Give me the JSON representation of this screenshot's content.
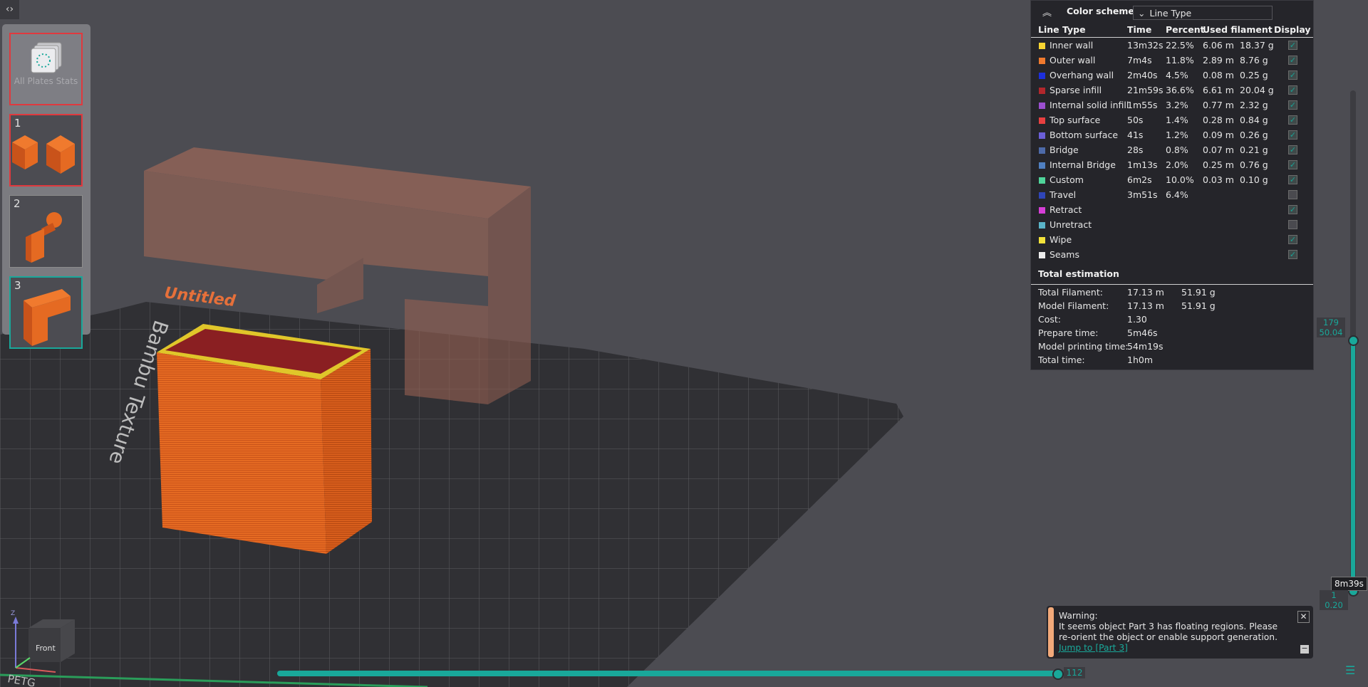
{
  "viewport": {
    "model_label": "Untitled",
    "bed_texture_text": "Bambu Texture",
    "bed_corner_text": "PETG"
  },
  "plates": {
    "all_stats_label": "All Plates Stats",
    "items": [
      {
        "number": "1",
        "thumbnail": "two-cubes-icon"
      },
      {
        "number": "2",
        "thumbnail": "joystick-part-icon"
      },
      {
        "number": "3",
        "thumbnail": "bracket-part-icon"
      }
    ]
  },
  "legend": {
    "title": "Color scheme",
    "scheme_value": "Line Type",
    "headers": {
      "type": "Line Type",
      "time": "Time",
      "percent": "Percent",
      "used": "Used filament",
      "display": "Display"
    },
    "rows": [
      {
        "name": "Inner wall",
        "color": "#f7d432",
        "time": "13m32s",
        "percent": "22.5%",
        "meters": "6.06 m",
        "grams": "18.37 g",
        "display": true
      },
      {
        "name": "Outer wall",
        "color": "#f07a2e",
        "time": "7m4s",
        "percent": "11.8%",
        "meters": "2.89 m",
        "grams": "8.76 g",
        "display": true
      },
      {
        "name": "Overhang wall",
        "color": "#1d2fdc",
        "time": "2m40s",
        "percent": "4.5%",
        "meters": "0.08 m",
        "grams": "0.25 g",
        "display": true
      },
      {
        "name": "Sparse infill",
        "color": "#b2272c",
        "time": "21m59s",
        "percent": "36.6%",
        "meters": "6.61 m",
        "grams": "20.04 g",
        "display": true
      },
      {
        "name": "Internal solid infill",
        "color": "#9b4fd0",
        "time": "1m55s",
        "percent": "3.2%",
        "meters": "0.77 m",
        "grams": "2.32 g",
        "display": true
      },
      {
        "name": "Top surface",
        "color": "#e84040",
        "time": "50s",
        "percent": "1.4%",
        "meters": "0.28 m",
        "grams": "0.84 g",
        "display": true
      },
      {
        "name": "Bottom surface",
        "color": "#6b5fd8",
        "time": "41s",
        "percent": "1.2%",
        "meters": "0.09 m",
        "grams": "0.26 g",
        "display": true
      },
      {
        "name": "Bridge",
        "color": "#4d6aa8",
        "time": "28s",
        "percent": "0.8%",
        "meters": "0.07 m",
        "grams": "0.21 g",
        "display": true
      },
      {
        "name": "Internal Bridge",
        "color": "#4f7fc0",
        "time": "1m13s",
        "percent": "2.0%",
        "meters": "0.25 m",
        "grams": "0.76 g",
        "display": true
      },
      {
        "name": "Custom",
        "color": "#4fd49a",
        "time": "6m2s",
        "percent": "10.0%",
        "meters": "0.03 m",
        "grams": "0.10 g",
        "display": true
      },
      {
        "name": "Travel",
        "color": "#2f45b8",
        "time": "3m51s",
        "percent": "6.4%",
        "meters": "",
        "grams": "",
        "display": false
      },
      {
        "name": "Retract",
        "color": "#d63ed6",
        "time": "",
        "percent": "",
        "meters": "",
        "grams": "",
        "display": true
      },
      {
        "name": "Unretract",
        "color": "#5ab4c8",
        "time": "",
        "percent": "",
        "meters": "",
        "grams": "",
        "display": false
      },
      {
        "name": "Wipe",
        "color": "#f2e23a",
        "time": "",
        "percent": "",
        "meters": "",
        "grams": "",
        "display": true
      },
      {
        "name": "Seams",
        "color": "#ececec",
        "time": "",
        "percent": "",
        "meters": "",
        "grams": "",
        "display": true
      }
    ],
    "total_title": "Total estimation",
    "totals": [
      {
        "label": "Total Filament:",
        "value": "17.13 m",
        "value2": "51.91 g"
      },
      {
        "label": "Model Filament:",
        "value": "17.13 m",
        "value2": "51.91 g"
      },
      {
        "label": "Cost:",
        "value": "1.30",
        "value2": ""
      },
      {
        "label": "Prepare time:",
        "value": "5m46s",
        "value2": ""
      },
      {
        "label": "Model printing time:",
        "value": "54m19s",
        "value2": ""
      },
      {
        "label": "Total time:",
        "value": "1h0m",
        "value2": ""
      }
    ]
  },
  "layer_slider": {
    "top_layer": "179",
    "top_height": "50.04",
    "bottom_layer": "1",
    "bottom_height": "0.20",
    "time_tip": "8m39s"
  },
  "move_slider": {
    "value": "112"
  },
  "warning": {
    "title": "Warning:",
    "message": "It seems object Part 3 has floating regions. Please re-orient the object or enable support generation.",
    "link": "Jump to [Part 3]"
  },
  "nav_cube": {
    "face_label": "Front",
    "axis_z": "Z"
  },
  "colors": {
    "accent": "#19a89a",
    "panel": "#25252a",
    "warning": "#f2a97a"
  }
}
